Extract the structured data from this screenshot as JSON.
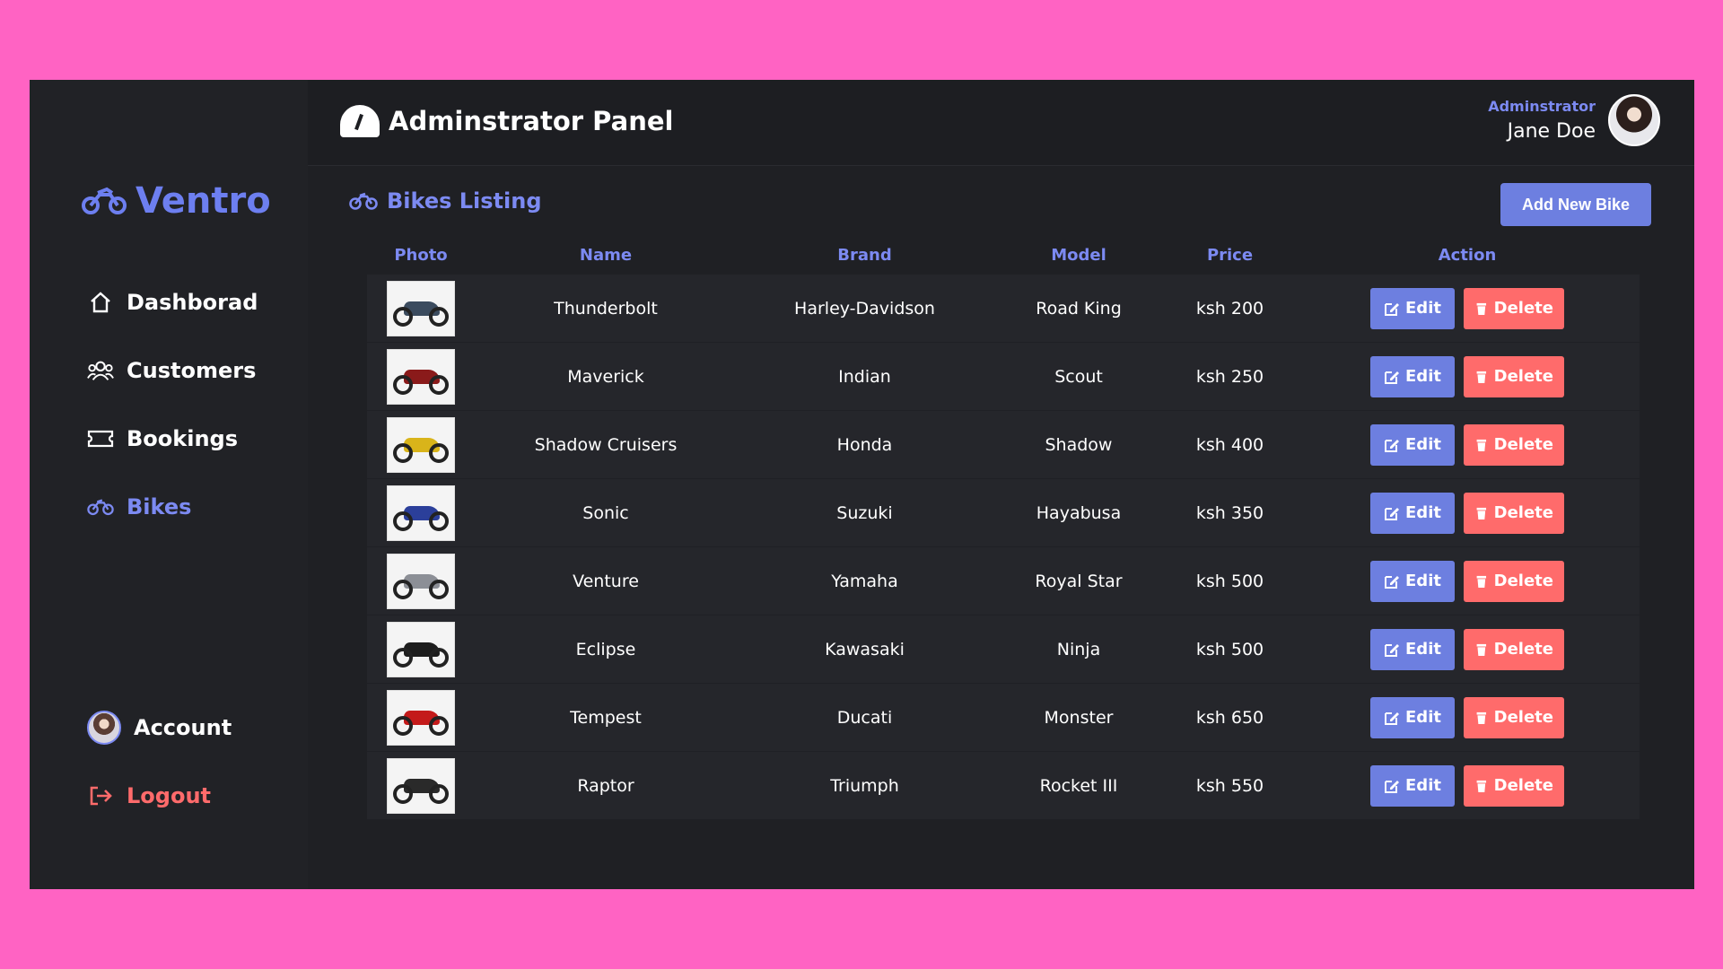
{
  "brand": {
    "name": "Ventro"
  },
  "header": {
    "title": "Adminstrator Panel",
    "user_role": "Adminstrator",
    "user_name": "Jane Doe"
  },
  "sidebar": {
    "items": [
      {
        "label": "Dashborad",
        "icon": "home-icon"
      },
      {
        "label": "Customers",
        "icon": "users-icon"
      },
      {
        "label": "Bookings",
        "icon": "ticket-icon"
      },
      {
        "label": "Bikes",
        "icon": "bike-icon"
      }
    ],
    "account_label": "Account",
    "logout_label": "Logout"
  },
  "listing": {
    "title": "Bikes Listing",
    "add_button": "Add New Bike",
    "columns": [
      "Photo",
      "Name",
      "Brand",
      "Model",
      "Price",
      "Action"
    ],
    "edit_label": "Edit",
    "delete_label": "Delete",
    "rows": [
      {
        "name": "Thunderbolt",
        "brand": "Harley-Davidson",
        "model": "Road King",
        "price": "ksh 200",
        "color": "#3b4b5e"
      },
      {
        "name": "Maverick",
        "brand": "Indian",
        "model": "Scout",
        "price": "ksh 250",
        "color": "#8a1a1a"
      },
      {
        "name": "Shadow Cruisers",
        "brand": "Honda",
        "model": "Shadow",
        "price": "ksh 400",
        "color": "#d9b41a"
      },
      {
        "name": "Sonic",
        "brand": "Suzuki",
        "model": "Hayabusa",
        "price": "ksh 350",
        "color": "#2b3f9a"
      },
      {
        "name": "Venture",
        "brand": "Yamaha",
        "model": "Royal Star",
        "price": "ksh 500",
        "color": "#8c8f96"
      },
      {
        "name": "Eclipse",
        "brand": "Kawasaki",
        "model": "Ninja",
        "price": "ksh 500",
        "color": "#1d1d1d"
      },
      {
        "name": "Tempest",
        "brand": "Ducati",
        "model": "Monster",
        "price": "ksh 650",
        "color": "#c41a1a"
      },
      {
        "name": "Raptor",
        "brand": "Triumph",
        "model": "Rocket III",
        "price": "ksh 550",
        "color": "#2a2a2a"
      }
    ]
  }
}
